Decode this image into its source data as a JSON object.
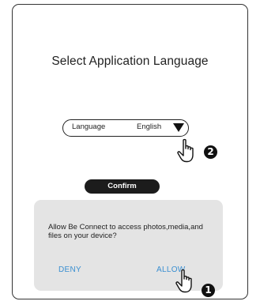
{
  "screen": {
    "title": "Select Application Language"
  },
  "language_select": {
    "label": "Language",
    "value": "English",
    "arrow_icon": "dropdown-triangle"
  },
  "confirm_button": {
    "label": "Confirm"
  },
  "permission_dialog": {
    "message": "Allow Be Connect to access photos,media,and files on your device?",
    "deny_label": "DENY",
    "allow_label": "ALLOW"
  },
  "annotations": {
    "step_language": "2",
    "step_allow": "1",
    "pointer_icon": "hand-pointer-icon"
  },
  "colors": {
    "dialog_background": "#e4e4e4",
    "dialog_button_text": "#3b8fd1",
    "confirm_background": "#1c1c1c"
  }
}
